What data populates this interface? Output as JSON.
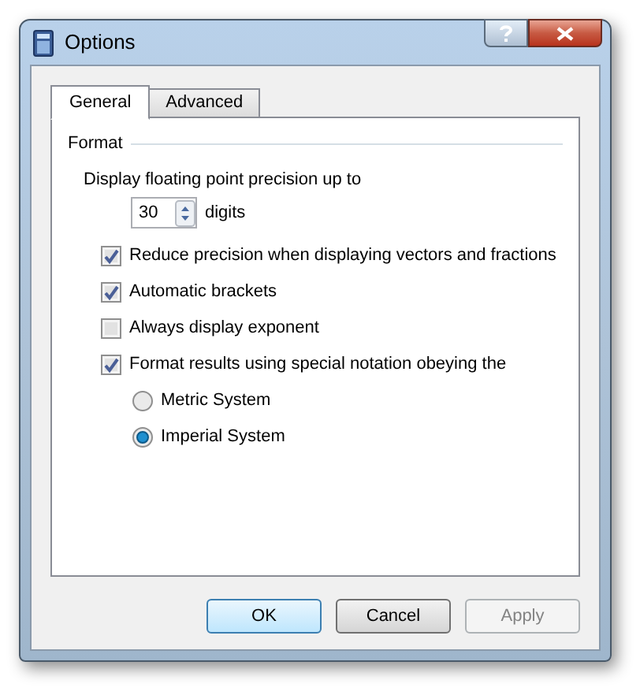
{
  "window": {
    "title": "Options"
  },
  "tabs": [
    {
      "label": "General",
      "selected": true
    },
    {
      "label": "Advanced",
      "selected": false
    }
  ],
  "group": {
    "title": "Format"
  },
  "precision": {
    "label": "Display floating point precision up to",
    "value": "30",
    "unit": "digits"
  },
  "options": [
    {
      "kind": "checkbox",
      "label": "Reduce precision when displaying vectors and fractions",
      "checked": true
    },
    {
      "kind": "checkbox",
      "label": "Automatic brackets",
      "checked": true
    },
    {
      "kind": "checkbox",
      "label": "Always display exponent",
      "checked": false
    },
    {
      "kind": "checkbox",
      "label": "Format results using special notation obeying the",
      "checked": true
    },
    {
      "kind": "radio",
      "label": "Metric System",
      "selected": false
    },
    {
      "kind": "radio",
      "label": "Imperial System",
      "selected": true
    }
  ],
  "buttons": [
    {
      "label": "OK",
      "default": true,
      "disabled": false
    },
    {
      "label": "Cancel",
      "default": false,
      "disabled": false
    },
    {
      "label": "Apply",
      "default": false,
      "disabled": true
    }
  ]
}
